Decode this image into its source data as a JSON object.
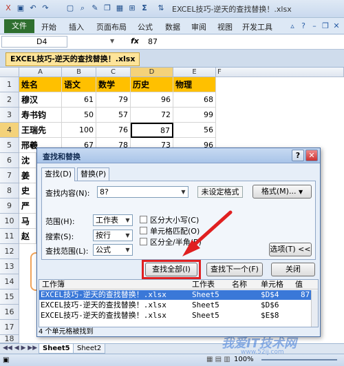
{
  "app": {
    "title": "EXCEL技巧-逆天的查找替换！.xlsx",
    "quick_icons": [
      "save-icon",
      "undo-icon",
      "redo-icon",
      "new-icon",
      "preview-icon",
      "format-painter-icon",
      "borders-icon",
      "autosum-icon",
      "sort-icon",
      "filter-icon"
    ],
    "autosum_glyph": "Σ"
  },
  "ribbon": {
    "file": "文件",
    "tabs": [
      "开始",
      "插入",
      "页面布局",
      "公式",
      "数据",
      "审阅",
      "视图",
      "开发工具"
    ]
  },
  "formula_bar": {
    "cell_ref": "D4",
    "fx": "fx",
    "value": "87"
  },
  "workbook_tab": "EXCEL技巧-逆天的查找替换！.xlsx",
  "sheet": {
    "columns": [
      "A",
      "B",
      "C",
      "D",
      "E",
      "F"
    ],
    "rows": [
      "1",
      "2",
      "3",
      "4",
      "5",
      "6",
      "7",
      "8",
      "9",
      "10",
      "11",
      "12",
      "13",
      "14",
      "15",
      "16",
      "17",
      "18"
    ],
    "header": [
      "姓名",
      "语文",
      "数学",
      "历史",
      "物理"
    ],
    "data": [
      [
        "穆汉",
        "61",
        "79",
        "96",
        "68"
      ],
      [
        "寿书钧",
        "50",
        "57",
        "72",
        "99"
      ],
      [
        "王瑞先",
        "100",
        "76",
        "87",
        "56"
      ],
      [
        "邢羲",
        "67",
        "78",
        "73",
        "96"
      ]
    ],
    "partial_names": [
      "沈",
      "姜",
      "史",
      "严",
      "马",
      "赵"
    ]
  },
  "sheet_tabs": [
    "Sheet5",
    "Sheet2"
  ],
  "status": {
    "zoom": "100%",
    "watermark": "我爱IT技术网",
    "watermark_url": "www.52ij.com"
  },
  "dialog": {
    "title": "查找和替换",
    "help": "?",
    "close": "✕",
    "tab_find": "查找(D)",
    "tab_replace": "替换(P)",
    "find_label": "查找内容(N):",
    "find_value": "8?",
    "format_status": "未设定格式",
    "format_btn": "格式(M)...",
    "scope_label": "范围(H):",
    "scope_value": "工作表",
    "search_label": "搜索(S):",
    "search_value": "按行",
    "lookin_label": "查找范围(L):",
    "lookin_value": "公式",
    "opt_case": "区分大小写(C)",
    "opt_whole": "单元格匹配(O)",
    "opt_width": "区分全/半角(B)",
    "options_btn": "选项(T) <<",
    "find_all": "查找全部(I)",
    "find_next": "查找下一个(F)",
    "close_btn": "关闭",
    "results_headers": [
      "工作簿",
      "工作表",
      "名称",
      "单元格",
      "值"
    ],
    "results": [
      {
        "book": "EXCEL技巧-逆天的查找替换！.xlsx",
        "sheet": "Sheet5",
        "name": "",
        "cell": "$D$4",
        "value": "87"
      },
      {
        "book": "EXCEL技巧-逆天的查找替换！.xlsx",
        "sheet": "Sheet5",
        "name": "",
        "cell": "$D$6",
        "value": ""
      },
      {
        "book": "EXCEL技巧-逆天的查找替换！.xlsx",
        "sheet": "Sheet5",
        "name": "",
        "cell": "$E$8",
        "value": ""
      }
    ],
    "status": "4 个单元格被找到"
  },
  "colors": {
    "highlight": "#ffc000",
    "annotation": "#e02020",
    "selection": "#3a78d8"
  }
}
